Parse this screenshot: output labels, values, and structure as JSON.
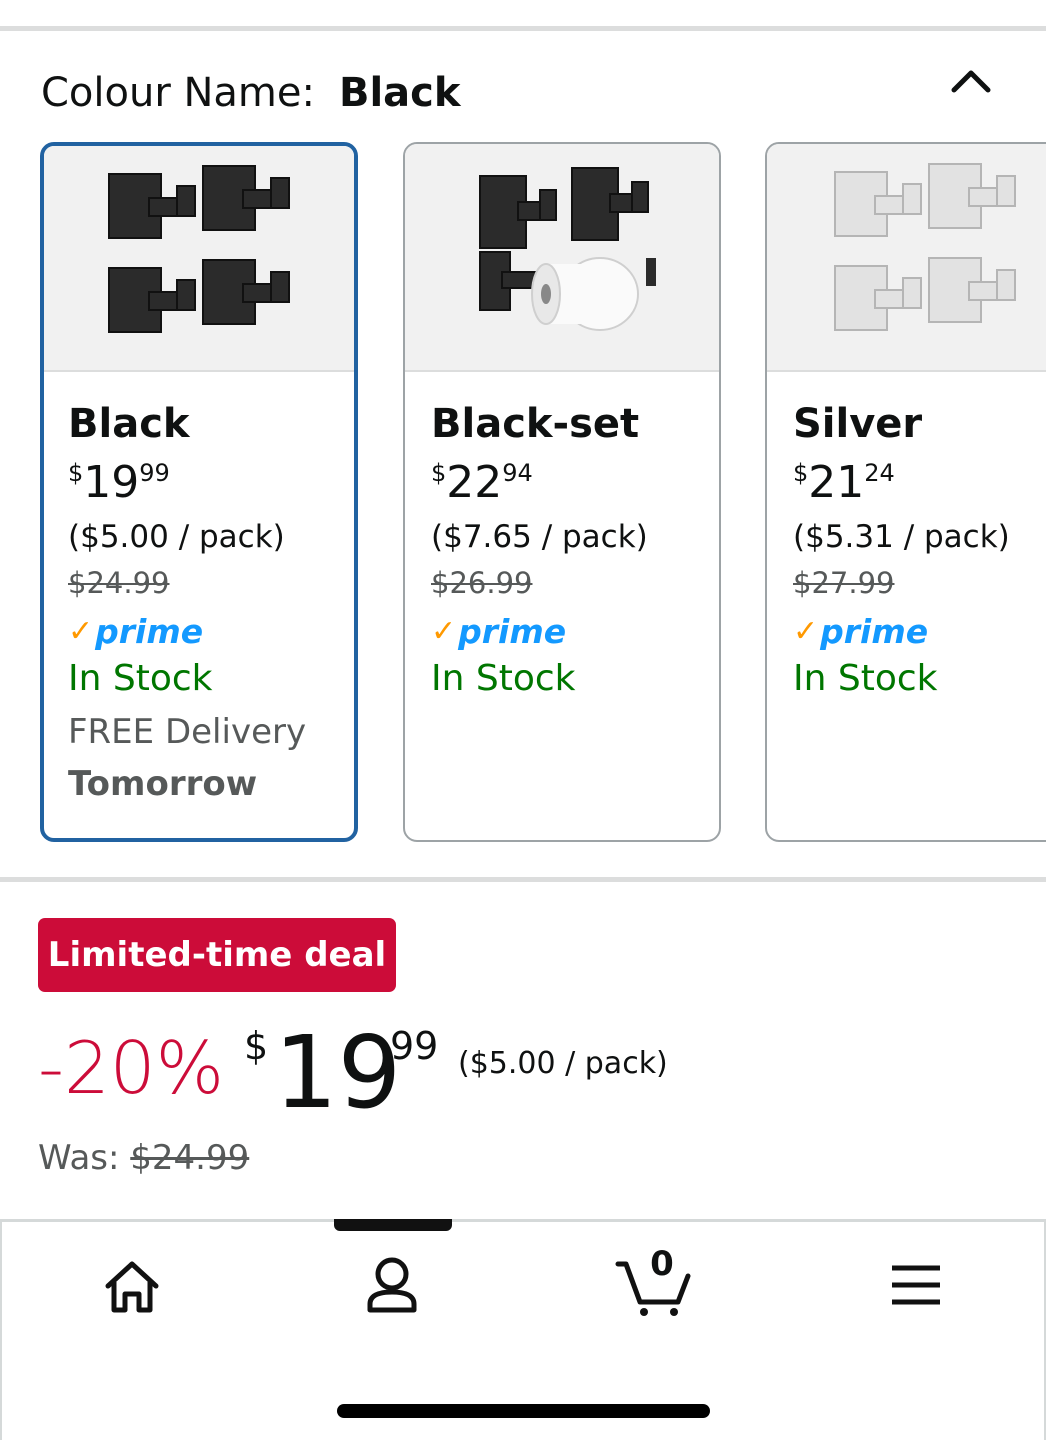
{
  "selector": {
    "label": "Colour Name:",
    "selected_value": "Black"
  },
  "variants": [
    {
      "name": "Black",
      "price_symbol": "$",
      "price_whole": "19",
      "price_fraction": "99",
      "unit_price": "($5.00 / pack)",
      "list_price": "$24.99",
      "prime": "prime",
      "availability": "In Stock",
      "delivery_line1": "FREE Delivery",
      "delivery_line2": "Tomorrow",
      "thumb_icon": "black-hooks-4pack-image"
    },
    {
      "name": "Black-set",
      "price_symbol": "$",
      "price_whole": "22",
      "price_fraction": "94",
      "unit_price": "($7.65 / pack)",
      "list_price": "$26.99",
      "prime": "prime",
      "availability": "In Stock",
      "thumb_icon": "black-hooks-and-toilet-roll-holder-image"
    },
    {
      "name": "Silver",
      "price_symbol": "$",
      "price_whole": "21",
      "price_fraction": "24",
      "unit_price": "($5.31 / pack)",
      "list_price": "$27.99",
      "prime": "prime",
      "availability": "In Stock",
      "thumb_icon": "silver-hooks-4pack-image"
    }
  ],
  "deal": {
    "badge": "Limited-time deal",
    "discount": "-20%",
    "price_symbol": "$",
    "price_whole": "19",
    "price_fraction": "99",
    "unit_price": "($5.00 / pack)",
    "was_label": "Was:",
    "was_price": "$24.99"
  },
  "bottom_nav": {
    "items": [
      "home-icon",
      "account-icon",
      "cart-icon",
      "menu-icon"
    ],
    "cart_count": "0"
  },
  "colors": {
    "selected_border": "#2162a1",
    "deal_red": "#cc0c39",
    "stock_green": "#007600",
    "prime_blue": "#1399ff",
    "prime_check": "#ff9900"
  }
}
